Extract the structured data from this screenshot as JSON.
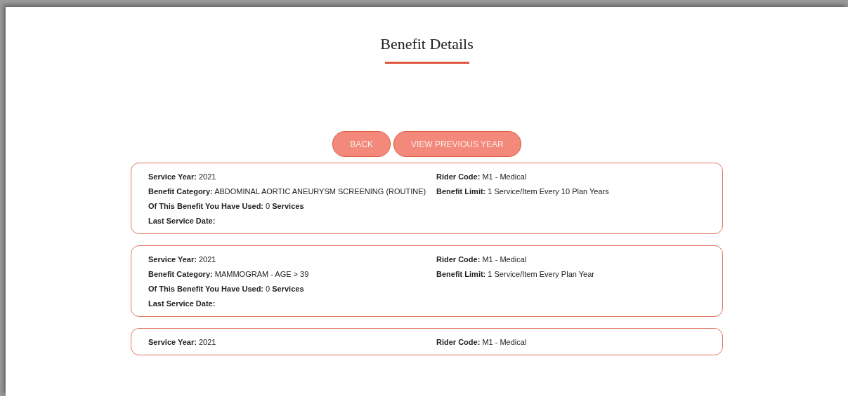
{
  "title": "Benefit Details",
  "buttons": [
    {
      "label": "BACK"
    },
    {
      "label": "VIEW PREVIOUS YEAR"
    }
  ],
  "cards": [
    {
      "left": [
        "**Service Year:** 2021",
        "**Benefit Category:** ABDOMINAL AORTIC ANEURYSM SCREENING (ROUTINE)",
        "**Of This Benefit You Have Used:** 0 **Services**",
        "**Last Service Date:**"
      ],
      "right": [
        "**Rider Code:** M1 - Medical",
        "**Benefit Limit:** 1 Service/Item Every 10 Plan Years"
      ]
    },
    {
      "left": [
        "**Service Year:** 2021",
        "**Benefit Category:** MAMMOGRAM - AGE > 39",
        "**Of This Benefit You Have Used:** 0 **Services**",
        "**Last Service Date:**"
      ],
      "right": [
        "**Rider Code:** M1 - Medical",
        "**Benefit Limit:** 1 Service/Item Every Plan Year"
      ]
    },
    {
      "left": [
        "**Service Year:** 2021"
      ],
      "right": [
        "**Rider Code:** M1 - Medical"
      ]
    }
  ]
}
